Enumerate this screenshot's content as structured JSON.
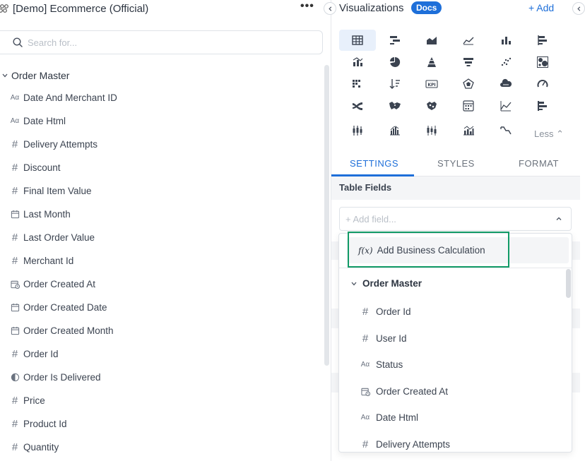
{
  "datasource": {
    "title": "[Demo] Ecommerce (Official)",
    "more_label": "•••"
  },
  "search": {
    "placeholder": "Search for..."
  },
  "left_group": {
    "name": "Order Master"
  },
  "left_fields": [
    {
      "icon": "text-type-icon",
      "glyph": "Aα",
      "label": "Date And Merchant ID"
    },
    {
      "icon": "text-type-icon",
      "glyph": "Aα",
      "label": "Date Html"
    },
    {
      "icon": "number-type-icon",
      "glyph": "#",
      "label": "Delivery Attempts"
    },
    {
      "icon": "number-type-icon",
      "glyph": "#",
      "label": "Discount"
    },
    {
      "icon": "number-type-icon",
      "glyph": "#",
      "label": "Final Item Value"
    },
    {
      "icon": "date-type-icon",
      "glyph": "cal",
      "label": "Last Month"
    },
    {
      "icon": "number-type-icon",
      "glyph": "#",
      "label": "Last Order Value"
    },
    {
      "icon": "number-type-icon",
      "glyph": "#",
      "label": "Merchant Id"
    },
    {
      "icon": "datetime-type-icon",
      "glyph": "calclock",
      "label": "Order Created At"
    },
    {
      "icon": "date-type-icon",
      "glyph": "cal",
      "label": "Order Created Date"
    },
    {
      "icon": "date-type-icon",
      "glyph": "cal",
      "label": "Order Created Month"
    },
    {
      "icon": "number-type-icon",
      "glyph": "#",
      "label": "Order Id"
    },
    {
      "icon": "boolean-type-icon",
      "glyph": "bool",
      "label": "Order Is Delivered"
    },
    {
      "icon": "number-type-icon",
      "glyph": "#",
      "label": "Price"
    },
    {
      "icon": "number-type-icon",
      "glyph": "#",
      "label": "Product Id"
    },
    {
      "icon": "number-type-icon",
      "glyph": "#",
      "label": "Quantity"
    }
  ],
  "visualizations": {
    "title": "Visualizations",
    "docs_label": "Docs",
    "add_label": "+ Add",
    "less_label": "Less",
    "icons": [
      "table-icon",
      "pivot-table-icon",
      "area-chart-icon",
      "line-chart-icon",
      "column-chart-icon",
      "bar-chart-icon",
      "combo-chart-icon",
      "pie-chart-icon",
      "pyramid-chart-icon",
      "funnel-chart-icon",
      "scatter-chart-icon",
      "bubble-chart-icon",
      "heatmap-icon",
      "sorted-list-icon",
      "kpi-icon",
      "radar-chart-icon",
      "word-cloud-icon",
      "gauge-icon",
      "sankey-icon",
      "geo-map-icon",
      "tree-map-icon",
      "calendar-heatmap-icon",
      "trend-chart-icon",
      "gantt-chart-icon",
      "box-plot-icon",
      "histogram-icon",
      "candlestick-icon",
      "column-line-icon",
      "waterfall-icon"
    ]
  },
  "tabs": [
    {
      "label": "SETTINGS",
      "active": true
    },
    {
      "label": "STYLES",
      "active": false
    },
    {
      "label": "FORMAT",
      "active": false
    }
  ],
  "settings": {
    "section_title": "Table Fields",
    "add_field_placeholder": "+ Add field..."
  },
  "dropdown": {
    "business_calc_label": "Add Business Calculation",
    "fx_glyph": "f(x)",
    "group_name": "Order Master",
    "items": [
      {
        "icon": "number-type-icon",
        "glyph": "#",
        "label": "Order Id"
      },
      {
        "icon": "number-type-icon",
        "glyph": "#",
        "label": "User Id"
      },
      {
        "icon": "text-type-icon",
        "glyph": "Aα",
        "label": "Status"
      },
      {
        "icon": "datetime-type-icon",
        "glyph": "calclock",
        "label": "Order Created At"
      },
      {
        "icon": "text-type-icon",
        "glyph": "Aα",
        "label": "Date Html"
      },
      {
        "icon": "number-type-icon",
        "glyph": "#",
        "label": "Delivery Attempts"
      }
    ]
  },
  "colors": {
    "accent": "#1e6fd9",
    "highlight_border": "#119a66",
    "section_bg": "#f4f5f7"
  }
}
